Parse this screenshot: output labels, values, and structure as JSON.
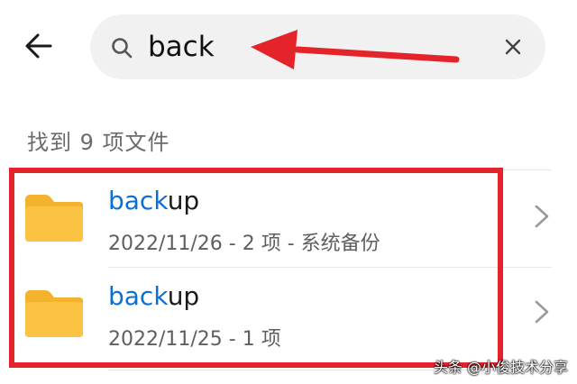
{
  "search": {
    "value": "back",
    "placeholder": ""
  },
  "results": {
    "count_label": "找到 9 项文件",
    "items": [
      {
        "name_highlight": "back",
        "name_rest": "up",
        "meta": "2022/11/26 - 2 项 - 系统备份",
        "icon": "folder-icon"
      },
      {
        "name_highlight": "back",
        "name_rest": "up",
        "meta": "2022/11/25 - 1 项",
        "icon": "folder-icon"
      }
    ]
  },
  "icons": {
    "back": "back-arrow-icon",
    "search": "search-icon",
    "clear": "close-icon",
    "chevron": "chevron-right-icon"
  },
  "colors": {
    "highlight_text": "#0a6fd8",
    "annotation_red": "#e4232b",
    "folder_yellow": "#fbc343",
    "search_bg": "#f1f1f1"
  },
  "watermark": "头条 @小俊技术分享"
}
